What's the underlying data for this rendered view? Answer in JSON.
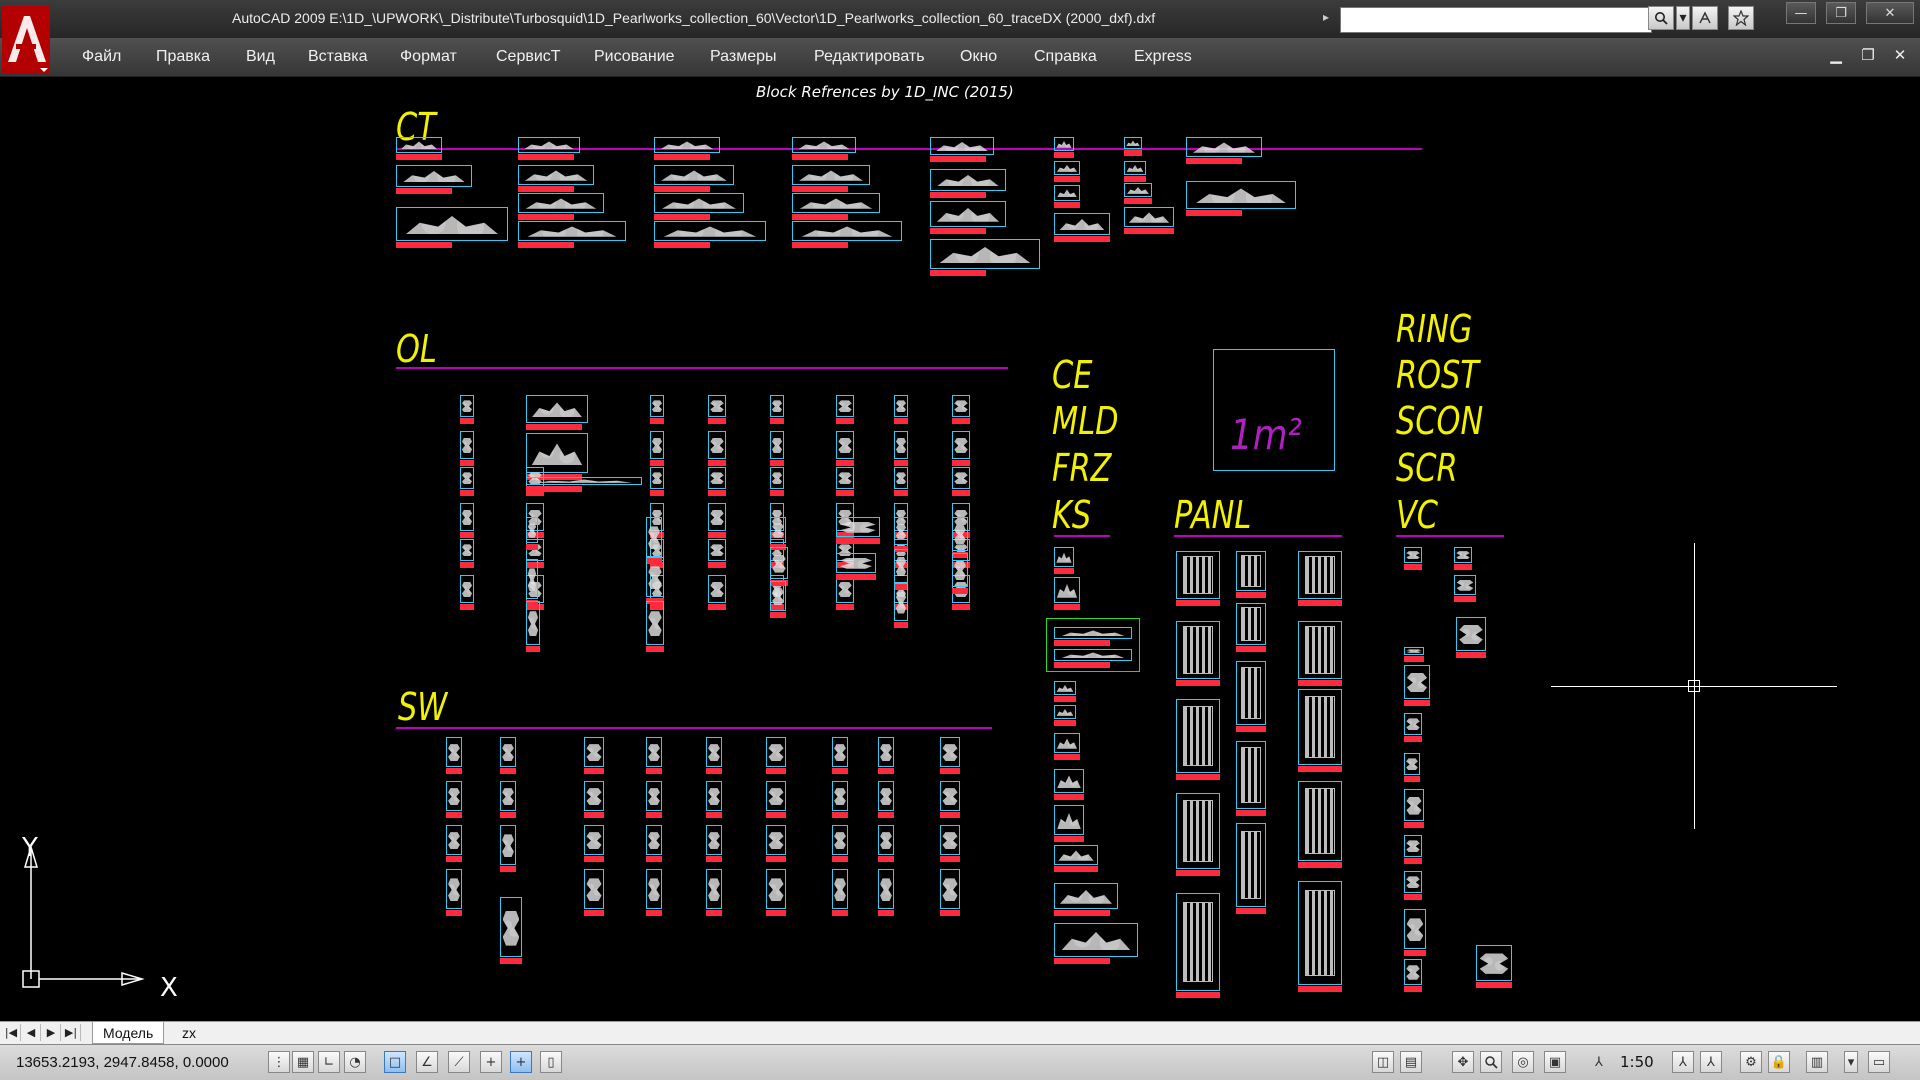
{
  "window": {
    "title": "AutoCAD 2009 E:\\1D_\\UPWORK\\_Distribute\\Turbosquid\\1D_Pearlworks_collection_60\\Vector\\1D_Pearlworks_collection_60_traceDX (2000_dxf).dxf",
    "logo_letter": "A",
    "title_arrow": "▸",
    "search_placeholder": ""
  },
  "menu": [
    "Файл",
    "Правка",
    "Вид",
    "Вставка",
    "Формат",
    "СервисТ",
    "Рисование",
    "Размеры",
    "Редактировать",
    "Окно",
    "Справка",
    "Express"
  ],
  "drawing": {
    "header": "Block Refrences by 1D_INC (2015)",
    "sections": {
      "ct": "CT",
      "ol": "OL",
      "sw": "SW",
      "ce": "CE",
      "mld": "MLD",
      "frz": "FRZ",
      "ks": "KS",
      "panl": "PANL",
      "ring": "RING",
      "rost": "ROST",
      "scon": "SCON",
      "scr": "SCR",
      "vc": "VC"
    },
    "area_label": "1m²",
    "ucs_y": "Y",
    "ucs_x": "X"
  },
  "tabs": {
    "model": "Модель",
    "layout": "zx"
  },
  "status": {
    "coordinates": "13653.2193, 2947.8458, 0.0000",
    "scale": "1:50"
  },
  "colors": {
    "label_yellow": "#f2f200",
    "line_magenta": "#c000c0",
    "block_cyan": "#33ccf0",
    "tag_red": "#ff2a3c",
    "area_magenta": "#b020c0"
  }
}
